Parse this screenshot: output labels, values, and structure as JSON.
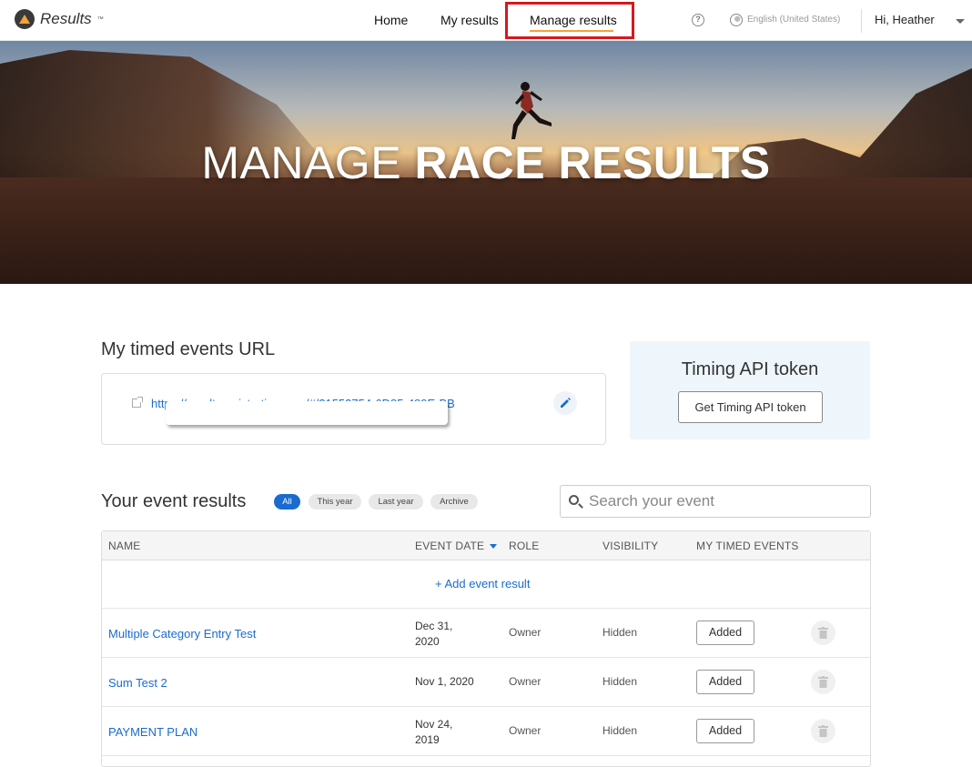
{
  "header": {
    "logo_text": "Results",
    "logo_tm": "™",
    "nav": {
      "home": "Home",
      "my_results": "My results",
      "manage_results": "Manage results"
    },
    "help_symbol": "?",
    "language": "English (United States)",
    "user_greeting": "Hi, Heather",
    "accent_color": "#f2a33a",
    "highlight_color": "#d6181e"
  },
  "hero": {
    "title_light": "MANAGE ",
    "title_bold": "RACE RESULTS"
  },
  "timed_events": {
    "title": "My timed events URL",
    "url": "https://resultsregistration.com/#/21552754-6D85-489E-BB"
  },
  "token": {
    "title": "Timing API token",
    "button": "Get Timing API token"
  },
  "results": {
    "title": "Your event results",
    "filters": [
      "All",
      "This year",
      "Last year",
      "Archive"
    ],
    "active_filter": "All",
    "search_placeholder": "Search your event",
    "columns": [
      "NAME",
      "EVENT DATE",
      "ROLE",
      "VISIBILITY",
      "MY TIMED EVENTS"
    ],
    "add_label": "+ Add event result",
    "rows": [
      {
        "name": "Multiple Category Entry Test",
        "date_line1": "Dec 31,",
        "date_line2": "2020",
        "role": "Owner",
        "visibility": "Hidden",
        "timed": "Added"
      },
      {
        "name": "Sum Test 2",
        "date_line1": "Nov 1, 2020",
        "date_line2": "",
        "role": "Owner",
        "visibility": "Hidden",
        "timed": "Added"
      },
      {
        "name": "PAYMENT PLAN",
        "date_line1": "Nov 24,",
        "date_line2": "2019",
        "role": "Owner",
        "visibility": "Hidden",
        "timed": "Added"
      }
    ]
  },
  "link_color": "#1a6bd0"
}
